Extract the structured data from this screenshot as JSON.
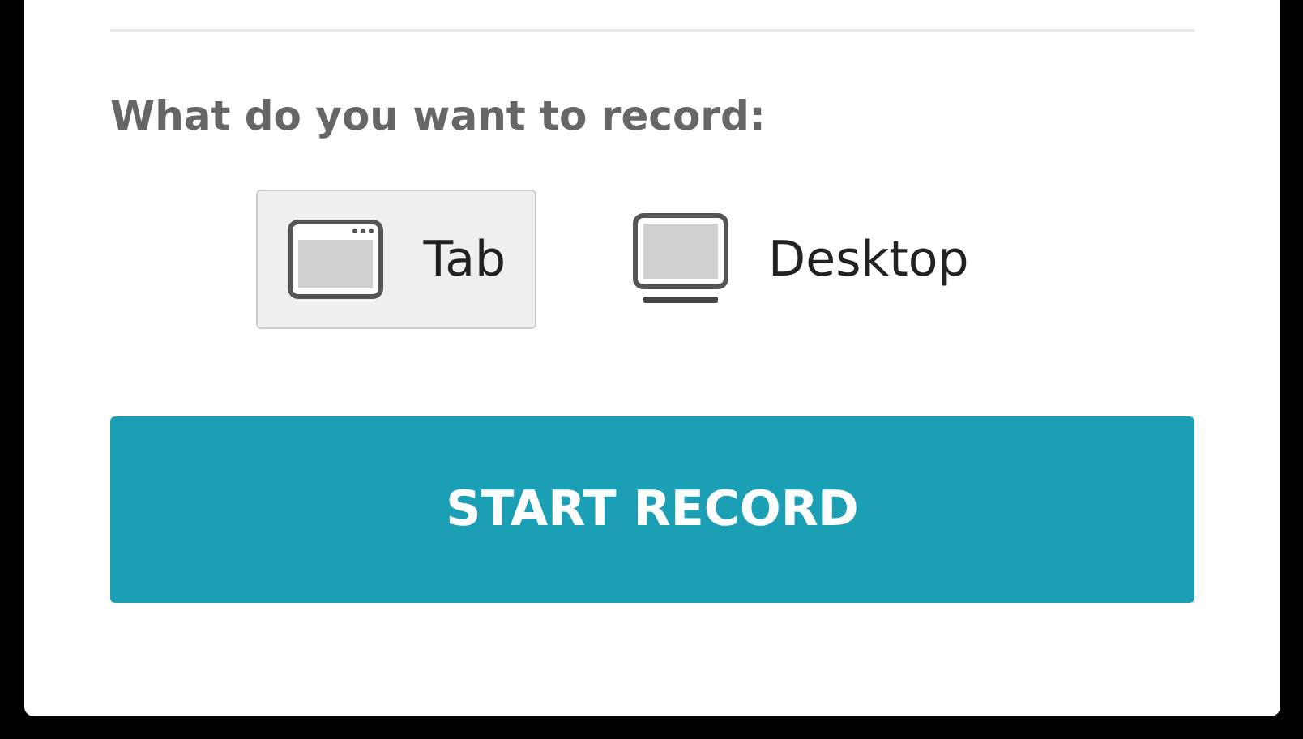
{
  "heading": "What do you want to record:",
  "options": [
    {
      "kind": "tab",
      "label": "Tab",
      "selected": true
    },
    {
      "kind": "desktop",
      "label": "Desktop",
      "selected": false
    }
  ],
  "button": "START RECORD"
}
